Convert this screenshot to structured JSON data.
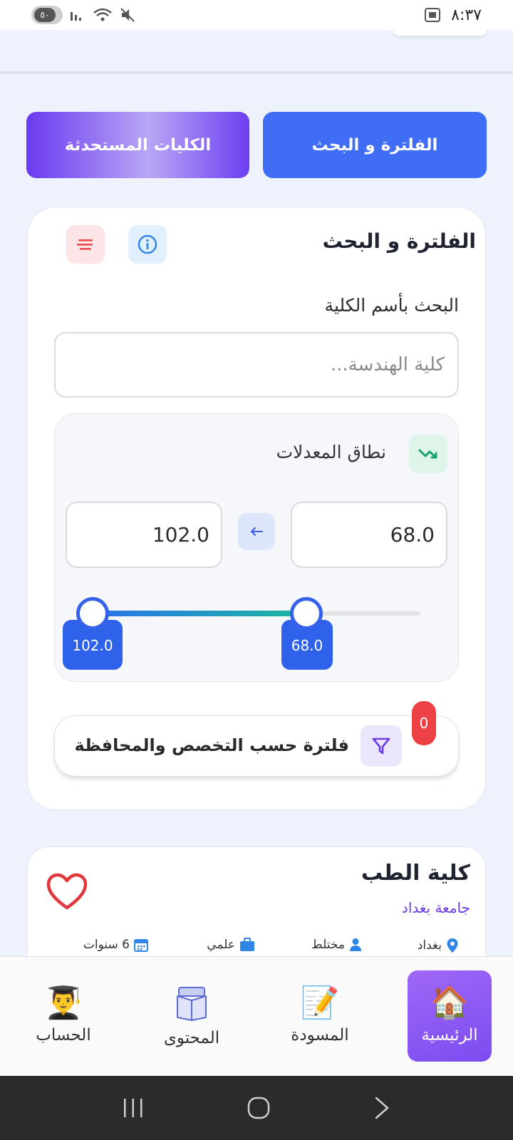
{
  "status_bar": {
    "time": "٨:٣٧",
    "battery": "٥٠"
  },
  "tabs": {
    "filter_search": "الفلترة و البحث",
    "new_colleges": "الكليات المستحدثة"
  },
  "filter_card": {
    "title": "الفلترة و البحث",
    "search_label": "البحث بأسم الكلية",
    "search_placeholder": "كلية الهندسة...",
    "search_value": ""
  },
  "gpa_range": {
    "title": "نطاق المعدلات",
    "min_value": "68.0",
    "max_value": "102.0",
    "slider_min_label": "68.0",
    "slider_max_label": "102.0"
  },
  "specialty_filter": {
    "label": "فلترة حسب التخصص والمحافظة",
    "count": "0"
  },
  "college": {
    "name": "كلية الطب",
    "university": "جامعة بغداد",
    "city": "بغداد",
    "gender": "مختلط",
    "branch": "علمي",
    "duration": "6 سنوات"
  },
  "bottom_nav": [
    {
      "label": "الرئيسية",
      "icon": "home-icon",
      "active": true
    },
    {
      "label": "المسودة",
      "icon": "pencil-memo-icon",
      "active": false
    },
    {
      "label": "المحتوى",
      "icon": "book-icon",
      "active": false
    },
    {
      "label": "الحساب",
      "icon": "graduate-icon",
      "active": false
    }
  ],
  "colors": {
    "primary_blue": "#3f6df5",
    "purple": "#6a3af0",
    "danger": "#ed4145",
    "green": "#1cb8a0"
  }
}
